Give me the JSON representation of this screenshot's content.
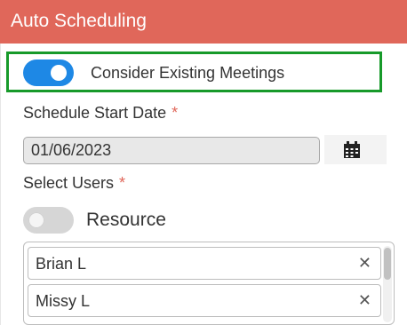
{
  "header": {
    "title": "Auto Scheduling",
    "color": "#e0675a"
  },
  "consider_meetings": {
    "label": "Consider Existing Meetings",
    "enabled": true,
    "highlight_color": "#179a2a"
  },
  "schedule_start": {
    "label": "Schedule Start Date",
    "required_mark": "*",
    "value": "01/06/2023",
    "icon": "calendar-icon"
  },
  "select_users": {
    "label": "Select Users",
    "required_mark": "*"
  },
  "resource": {
    "label": "Resource",
    "enabled": false
  },
  "users": [
    {
      "name": "Brian L",
      "remove": "✕"
    },
    {
      "name": "Missy L",
      "remove": "✕"
    }
  ],
  "accent_color": "#1e88e5"
}
